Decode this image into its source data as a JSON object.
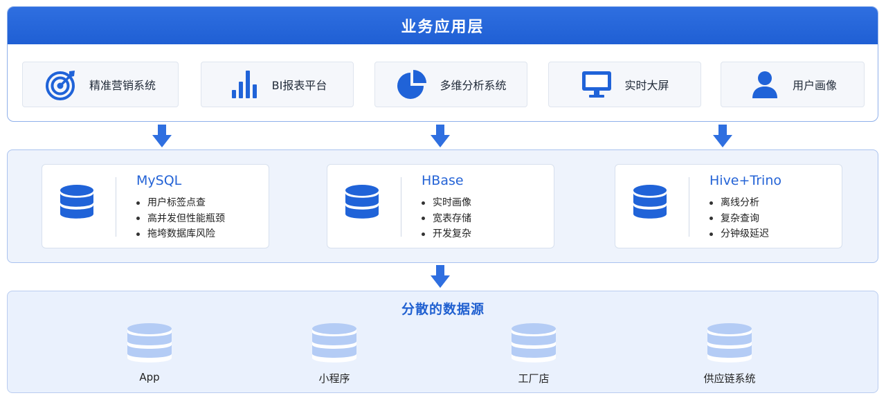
{
  "top_layer": {
    "title": "业务应用层",
    "apps": [
      {
        "label": "精准营销系统",
        "icon": "target-icon"
      },
      {
        "label": "BI报表平台",
        "icon": "bar-chart-icon"
      },
      {
        "label": "多维分析系统",
        "icon": "pie-chart-icon"
      },
      {
        "label": "实时大屏",
        "icon": "monitor-icon"
      },
      {
        "label": "用户画像",
        "icon": "user-icon"
      }
    ]
  },
  "storage_layer": {
    "stores": [
      {
        "name": "MySQL",
        "points": [
          "用户标签点查",
          "高并发但性能瓶颈",
          "拖垮数据库风险"
        ]
      },
      {
        "name": "HBase",
        "points": [
          "实时画像",
          "宽表存储",
          "开发复杂"
        ]
      },
      {
        "name": "Hive+Trino",
        "points": [
          "离线分析",
          "复杂查询",
          "分钟级延迟"
        ]
      }
    ]
  },
  "source_layer": {
    "title": "分散的数据源",
    "sources": [
      "App",
      "小程序",
      "工厂店",
      "供应链系统"
    ]
  },
  "colors": {
    "primary": "#2063d8",
    "header_blue": "#2a68dc",
    "panel_bg": "#eef3fc",
    "source_db": "#b4ccf5"
  }
}
